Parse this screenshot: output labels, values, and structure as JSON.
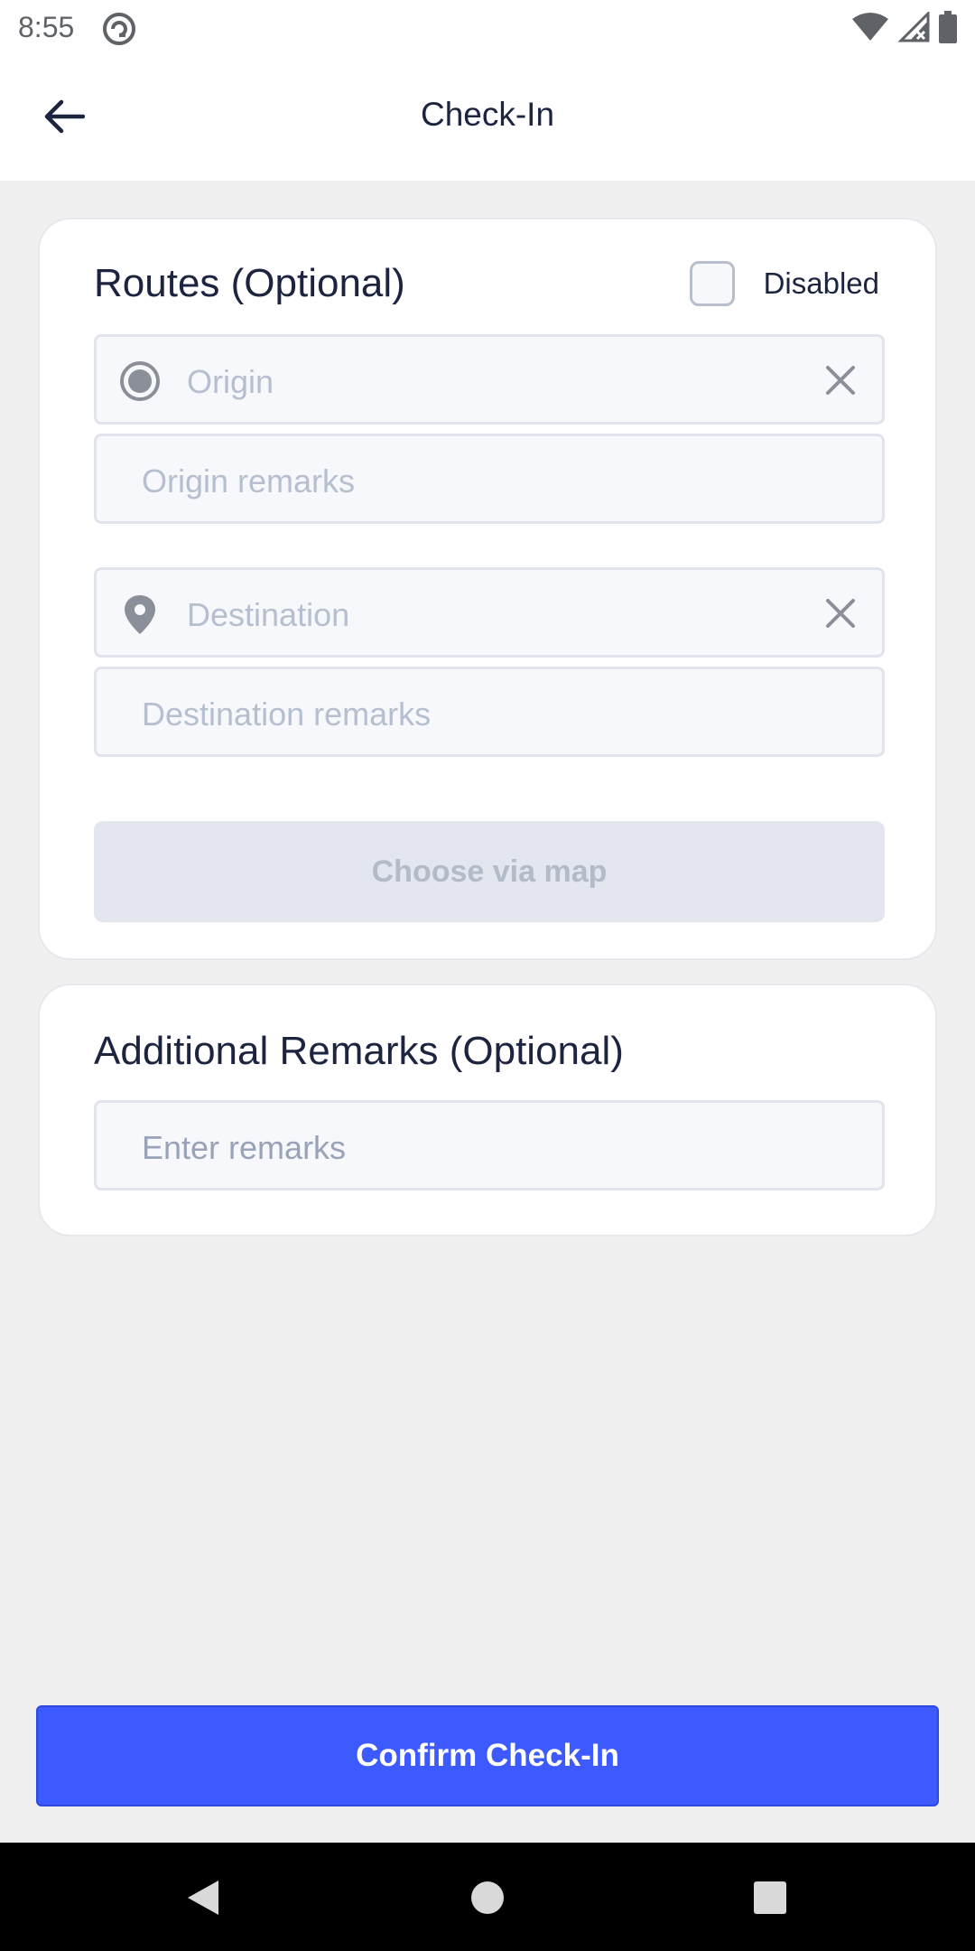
{
  "status_bar": {
    "time": "8:55",
    "icons": [
      "app-notification-icon",
      "wifi-icon",
      "signal-icon",
      "battery-icon"
    ]
  },
  "app_bar": {
    "title": "Check-In",
    "back_icon": "arrow-left-icon"
  },
  "routes": {
    "title": "Routes (Optional)",
    "toggle_label": "Disabled",
    "toggle_checked": false,
    "origin": {
      "placeholder": "Origin",
      "value": "",
      "icon": "radio-dot-icon"
    },
    "origin_remarks": {
      "placeholder": "Origin remarks",
      "value": ""
    },
    "destination": {
      "placeholder": "Destination",
      "value": "",
      "icon": "location-pin-icon"
    },
    "destination_remarks": {
      "placeholder": "Destination remarks",
      "value": ""
    },
    "map_button_label": "Choose via map"
  },
  "additional_remarks": {
    "title": "Additional Remarks (Optional)",
    "placeholder": "Enter remarks",
    "value": ""
  },
  "confirm_button_label": "Confirm Check-In",
  "colors": {
    "primary": "#3d5afe",
    "title_text": "#1c2440",
    "placeholder": "#b5bfcf",
    "disabled_button_bg": "#e3e6ee"
  },
  "nav_bar": {
    "icons": [
      "back-triangle-icon",
      "home-circle-icon",
      "recents-square-icon"
    ]
  }
}
